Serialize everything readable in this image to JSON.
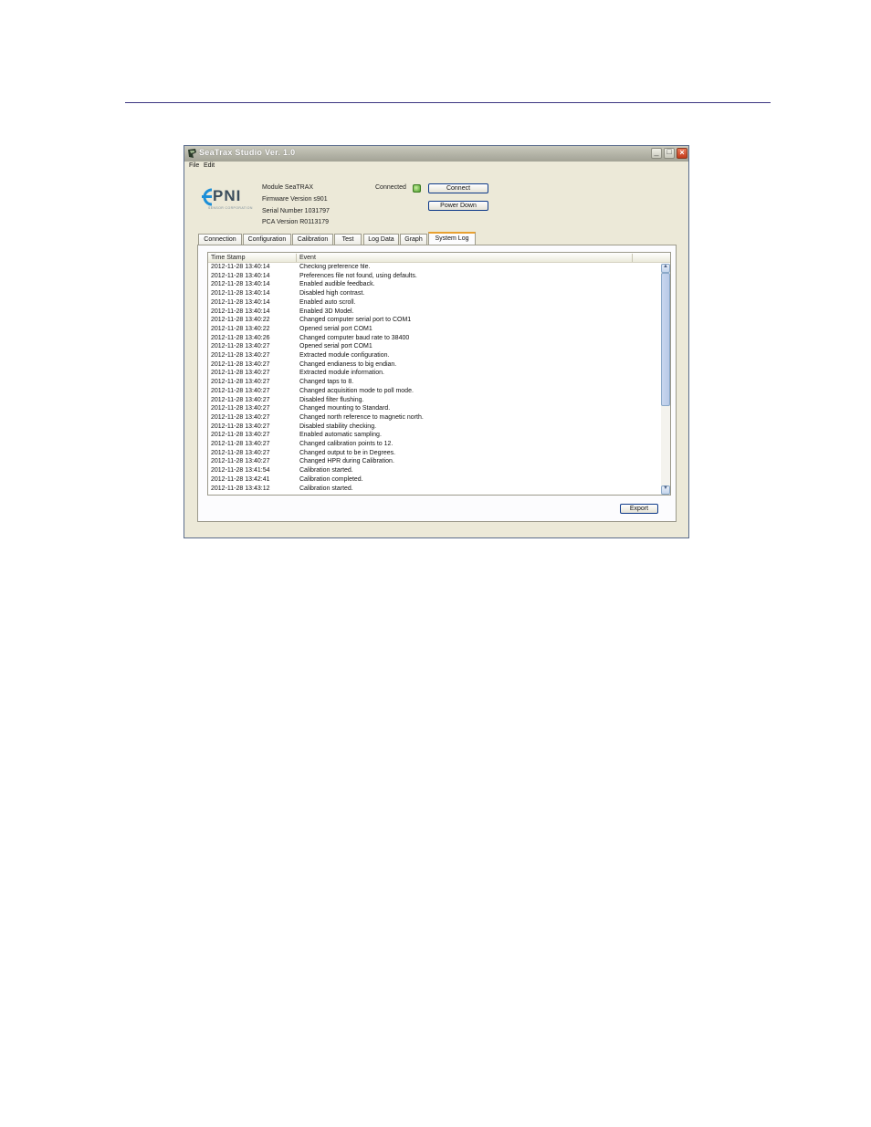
{
  "window": {
    "title": "SeaTrax Studio Ver. 1.0"
  },
  "menu": {
    "file": "File",
    "edit": "Edit"
  },
  "logo": {
    "text": "PNI",
    "subtitle": "SENSOR CORPORATION"
  },
  "module_info": {
    "module": "Module SeaTRAX",
    "firmware": "Firmware Version s901",
    "serial": "Serial Number 1031797",
    "pca": "PCA Version R0113179"
  },
  "status": {
    "connected_label": "Connected",
    "led_color": "#4a9a28"
  },
  "buttons": {
    "connect": "Connect",
    "power_down": "Power Down",
    "export": "Export"
  },
  "tabs": [
    "Connection",
    "Configuration",
    "Calibration",
    "Test",
    "Log Data",
    "Graph",
    "System Log"
  ],
  "active_tab": "System Log",
  "log": {
    "columns": {
      "time": "Time Stamp",
      "event": "Event"
    },
    "rows": [
      {
        "time": "2012-11-28 13:40:14",
        "event": "Checking preference file."
      },
      {
        "time": "2012-11-28 13:40:14",
        "event": "Preferences file not found, using defaults."
      },
      {
        "time": "2012-11-28 13:40:14",
        "event": "Enabled audible feedback."
      },
      {
        "time": "2012-11-28 13:40:14",
        "event": "Disabled high contrast."
      },
      {
        "time": "2012-11-28 13:40:14",
        "event": "Enabled auto scroll."
      },
      {
        "time": "2012-11-28 13:40:14",
        "event": "Enabled 3D Model."
      },
      {
        "time": "2012-11-28 13:40:22",
        "event": "Changed computer serial port to COM1"
      },
      {
        "time": "2012-11-28 13:40:22",
        "event": "Opened serial port COM1"
      },
      {
        "time": "2012-11-28 13:40:26",
        "event": "Changed computer baud rate to 38400"
      },
      {
        "time": "2012-11-28 13:40:27",
        "event": "Opened serial port COM1"
      },
      {
        "time": "2012-11-28 13:40:27",
        "event": "Extracted module configuration."
      },
      {
        "time": "2012-11-28 13:40:27",
        "event": "Changed endianess to big endian."
      },
      {
        "time": "2012-11-28 13:40:27",
        "event": "Extracted module information."
      },
      {
        "time": "2012-11-28 13:40:27",
        "event": "Changed taps to 8."
      },
      {
        "time": "2012-11-28 13:40:27",
        "event": "Changed acquisition mode to poll mode."
      },
      {
        "time": "2012-11-28 13:40:27",
        "event": "Disabled filter flushing."
      },
      {
        "time": "2012-11-28 13:40:27",
        "event": "Changed mounting to Standard."
      },
      {
        "time": "2012-11-28 13:40:27",
        "event": "Changed north reference to magnetic north."
      },
      {
        "time": "2012-11-28 13:40:27",
        "event": "Disabled stability checking."
      },
      {
        "time": "2012-11-28 13:40:27",
        "event": "Enabled automatic sampling."
      },
      {
        "time": "2012-11-28 13:40:27",
        "event": "Changed calibration points to 12."
      },
      {
        "time": "2012-11-28 13:40:27",
        "event": "Changed output to be in Degrees."
      },
      {
        "time": "2012-11-28 13:40:27",
        "event": "Changed HPR during Calibration."
      },
      {
        "time": "2012-11-28 13:41:54",
        "event": "Calibration started."
      },
      {
        "time": "2012-11-28 13:42:41",
        "event": "Calibration completed."
      },
      {
        "time": "2012-11-28 13:43:12",
        "event": "Calibration started."
      }
    ]
  },
  "scrollbar_position": 0
}
